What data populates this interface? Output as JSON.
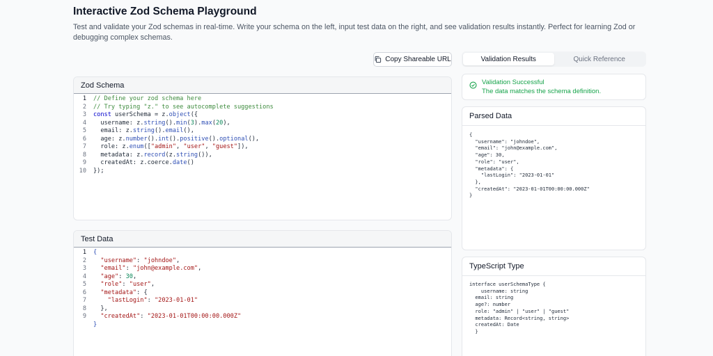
{
  "page": {
    "title": "Interactive Zod Schema Playground",
    "description": "Test and validate your Zod schemas in real-time. Write your schema on the left, input test data on the right, and see validation results instantly. Perfect for learning Zod or debugging complex schemas."
  },
  "toolbar": {
    "copy_url_label": "Copy Shareable URL",
    "copy_icon": "copy-icon"
  },
  "tabs": [
    {
      "label": "Validation Results",
      "active": true
    },
    {
      "label": "Quick Reference",
      "active": false
    }
  ],
  "schema_editor": {
    "title": "Zod Schema",
    "lines": [
      "1",
      "2",
      "3",
      "4",
      "5",
      "6",
      "7",
      "8",
      "9",
      "10"
    ]
  },
  "test_editor": {
    "title": "Test Data",
    "lines": [
      "1",
      "2",
      "3",
      "4",
      "5",
      "6",
      "7",
      "8",
      "9"
    ]
  },
  "validation": {
    "title": "Validation Successful",
    "message": "The data matches the schema definition.",
    "icon": "check-circle-icon",
    "color": "#16a34a"
  },
  "parsed_data": {
    "title": "Parsed Data",
    "content": "{\n  \"username\": \"johndoe\",\n  \"email\": \"john@example.com\",\n  \"age\": 30,\n  \"role\": \"user\",\n  \"metadata\": {\n    \"lastLogin\": \"2023-01-01\"\n  },\n  \"createdAt\": \"2023-01-01T00:00:00.000Z\"\n}"
  },
  "ts_type": {
    "title": "TypeScript Type",
    "content": "interface userSchemaType {\n    username: string\n  email: string\n  age?: number\n  role: \"admin\" | \"user\" | \"guest\"\n  metadata: Record<string, string>\n  createdAt: Date\n  }"
  },
  "colors": {
    "success": "#16a34a",
    "comment": "#3d8b3d",
    "string": "#a31515",
    "number": "#098658",
    "function": "#2f4fb5"
  }
}
